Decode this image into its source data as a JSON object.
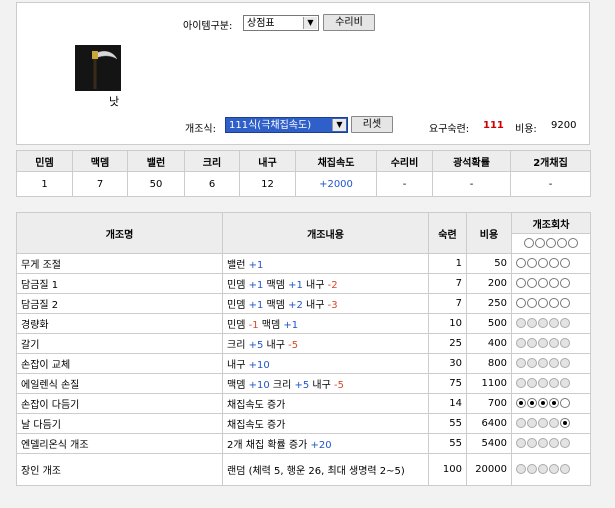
{
  "item": {
    "name": "낫",
    "icon": "scythe-icon"
  },
  "category": {
    "label": "아이템구분:",
    "value": "상점표",
    "repair_button": "수리비"
  },
  "mod": {
    "label": "개조식:",
    "value": "111식(극채집속도)",
    "reset_button": "리셋",
    "req_skill_label": "요구숙련:",
    "req_skill_value": "111",
    "cost_label": "비용:",
    "cost_value": "9200"
  },
  "stats": {
    "headers": [
      "민뎀",
      "맥뎀",
      "밸런",
      "크리",
      "내구",
      "채집속도",
      "수리비",
      "광석확률",
      "2개채집"
    ],
    "values": [
      "1",
      "7",
      "50",
      "6",
      "12",
      "+2000",
      "-",
      "-",
      "-"
    ]
  },
  "mods_table": {
    "headers": [
      "개조명",
      "개조내용",
      "숙련",
      "비용",
      "개조회차"
    ],
    "rows": [
      {
        "name": "무게 조절",
        "effect": [
          {
            "t": "밸런 "
          },
          {
            "t": "+1",
            "c": "blue"
          }
        ],
        "skill": "1",
        "cost": "50",
        "radios": {
          "type": "enabled",
          "selected": 0
        }
      },
      {
        "name": "담금질 1",
        "effect": [
          {
            "t": "민뎀 "
          },
          {
            "t": "+1",
            "c": "blue"
          },
          {
            "t": " 맥뎀 "
          },
          {
            "t": "+1",
            "c": "blue"
          },
          {
            "t": " 내구 "
          },
          {
            "t": "-2",
            "c": "red"
          }
        ],
        "skill": "7",
        "cost": "200",
        "radios": {
          "type": "enabled",
          "selected": 0
        }
      },
      {
        "name": "담금질 2",
        "effect": [
          {
            "t": "민뎀 "
          },
          {
            "t": "+1",
            "c": "blue"
          },
          {
            "t": " 맥뎀 "
          },
          {
            "t": "+2",
            "c": "blue"
          },
          {
            "t": " 내구 "
          },
          {
            "t": "-3",
            "c": "red"
          }
        ],
        "skill": "7",
        "cost": "250",
        "radios": {
          "type": "enabled",
          "selected": 0
        }
      },
      {
        "name": "경량화",
        "effect": [
          {
            "t": "민뎀 "
          },
          {
            "t": "-1",
            "c": "red"
          },
          {
            "t": " 맥뎀 "
          },
          {
            "t": "+1",
            "c": "blue"
          }
        ],
        "skill": "10",
        "cost": "500",
        "radios": {
          "type": "disabled",
          "selected": 0
        }
      },
      {
        "name": "갈기",
        "effect": [
          {
            "t": "크리 "
          },
          {
            "t": "+5",
            "c": "blue"
          },
          {
            "t": " 내구 "
          },
          {
            "t": "-5",
            "c": "red"
          }
        ],
        "skill": "25",
        "cost": "400",
        "radios": {
          "type": "disabled",
          "selected": 0
        }
      },
      {
        "name": "손잡이 교체",
        "effect": [
          {
            "t": "내구 "
          },
          {
            "t": "+10",
            "c": "blue"
          }
        ],
        "skill": "30",
        "cost": "800",
        "radios": {
          "type": "disabled",
          "selected": 0
        }
      },
      {
        "name": "에일렌식 손질",
        "effect": [
          {
            "t": "맥뎀 "
          },
          {
            "t": "+10",
            "c": "blue"
          },
          {
            "t": " 크리 "
          },
          {
            "t": "+5",
            "c": "blue"
          },
          {
            "t": " 내구 "
          },
          {
            "t": "-5",
            "c": "red"
          }
        ],
        "skill": "75",
        "cost": "1100",
        "radios": {
          "type": "disabled",
          "selected": 0
        }
      },
      {
        "name": "손잡이 다듬기",
        "effect": [
          {
            "t": "채집속도 증가"
          }
        ],
        "skill": "14",
        "cost": "700",
        "radios": {
          "type": "enabled",
          "selected": 4
        }
      },
      {
        "name": "날 다듬기",
        "effect": [
          {
            "t": "채집속도 증가"
          }
        ],
        "skill": "55",
        "cost": "6400",
        "radios": {
          "type": "last",
          "selected": 1
        }
      },
      {
        "name": "엔델리온식 개조",
        "effect": [
          {
            "t": "2개 채집 확률 증가 "
          },
          {
            "t": "+20",
            "c": "blue"
          }
        ],
        "skill": "55",
        "cost": "5400",
        "radios": {
          "type": "disabled",
          "selected": 0
        }
      },
      {
        "name": "장인 개조",
        "effect": [
          {
            "t": "랜덤 (체력 5, 행운 26, 최대 생명력 2~5)"
          }
        ],
        "skill": "100",
        "cost": "20000",
        "radios": {
          "type": "disabled",
          "selected": 0
        }
      }
    ]
  }
}
